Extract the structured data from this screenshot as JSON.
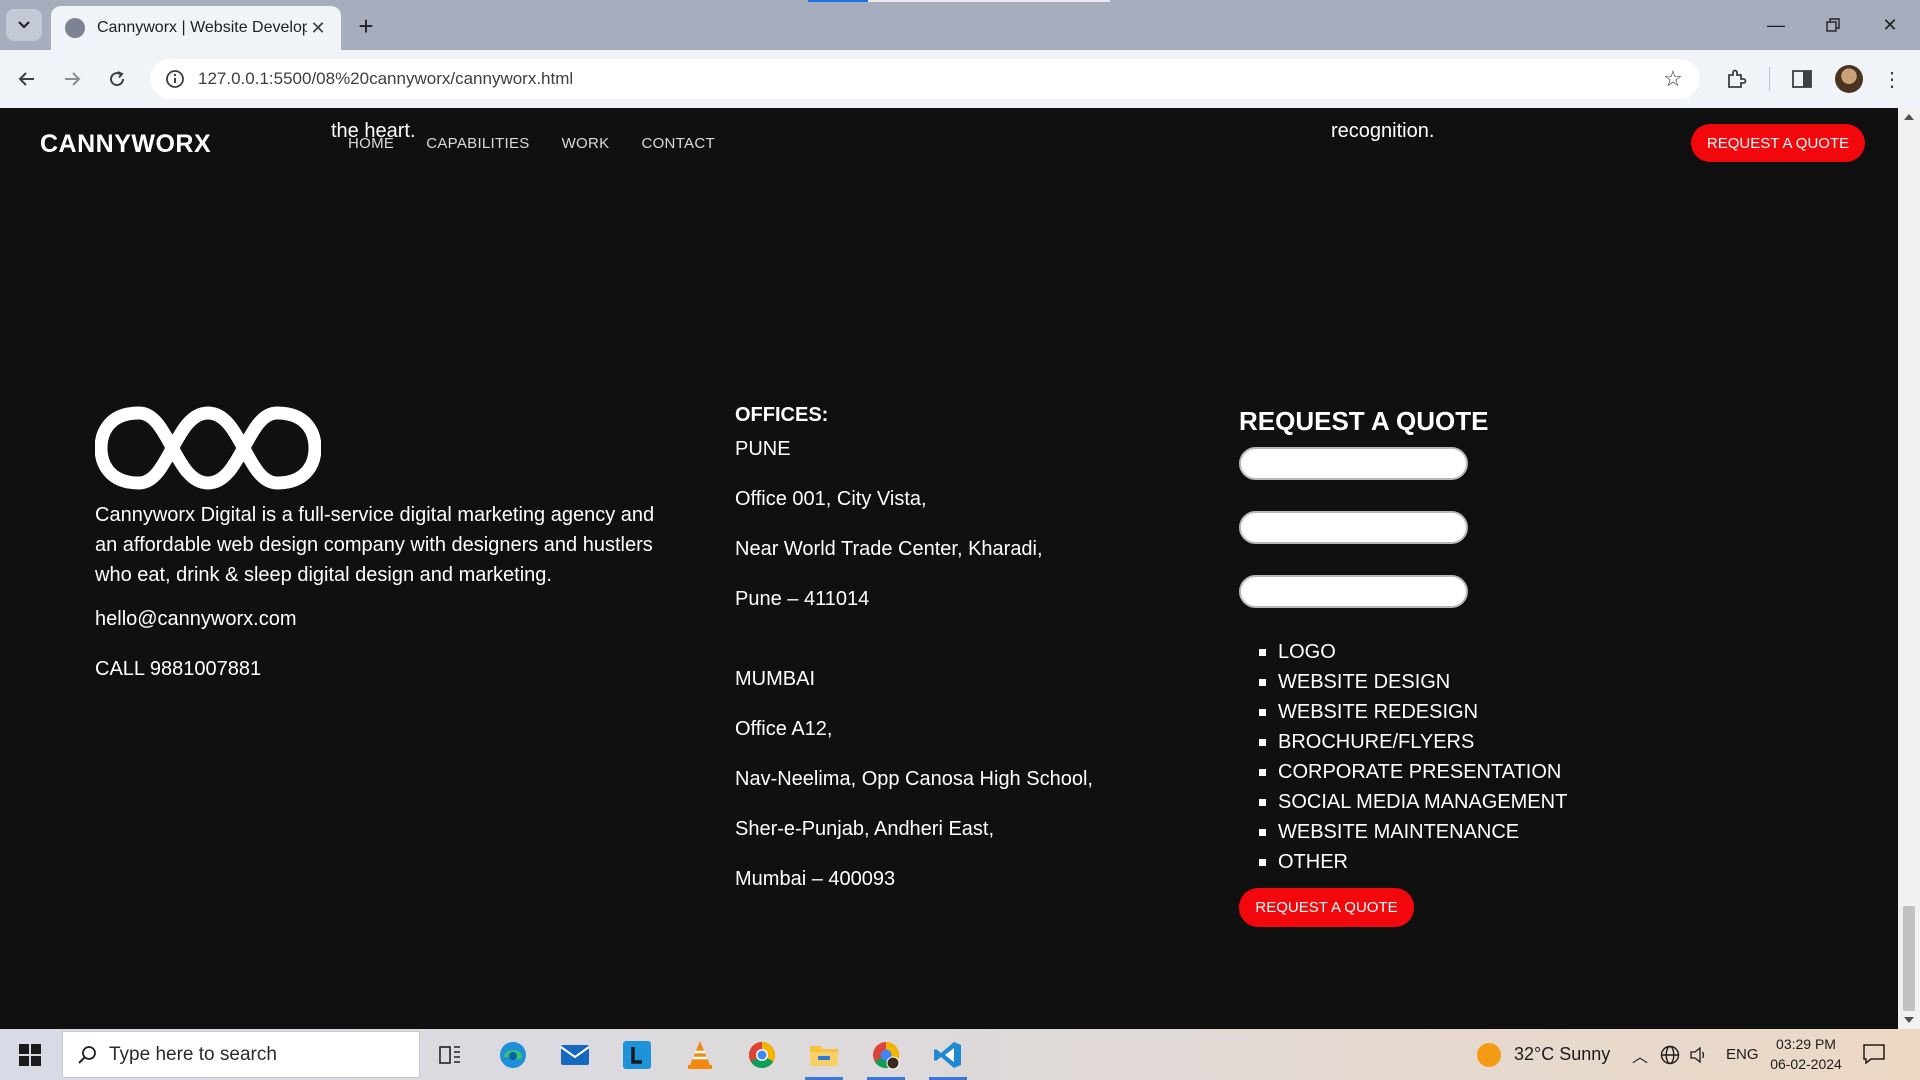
{
  "browser": {
    "tab_title": "Cannyworx | Website Developm",
    "url": "127.0.0.1:5500/08%20cannyworx/cannyworx.html"
  },
  "page": {
    "behind_left": "the heart.",
    "behind_right": "recognition.",
    "header": {
      "logo": "CANNYWORX",
      "nav": [
        "HOME",
        "CAPABILITIES",
        "WORK",
        "CONTACT"
      ],
      "quote_button": "REQUEST A QUOTE"
    },
    "footer": {
      "about": "Cannyworx Digital is a full-service digital marketing agency and an affordable web design company with designers and hustlers who eat, drink & sleep digital design and marketing.",
      "email": "hello@cannyworx.com",
      "phone": "CALL 9881007881",
      "offices_heading": "OFFICES:",
      "pune": [
        "PUNE",
        "Office 001, City Vista,",
        "Near World Trade Center, Kharadi,",
        "Pune – 411014"
      ],
      "mumbai": [
        "MUMBAI",
        "Office A12,",
        "Nav-Neelima, Opp Canosa High School,",
        "Sher-e-Punjab, Andheri East,",
        "Mumbai – 400093"
      ],
      "quote_heading": "REQUEST A QUOTE",
      "services": [
        "LOGO",
        "WEBSITE DESIGN",
        "WEBSITE REDESIGN",
        "BROCHURE/FLYERS",
        "CORPORATE PRESENTATION",
        "SOCIAL MEDIA MANAGEMENT",
        "WEBSITE MAINTENANCE",
        "OTHER"
      ],
      "submit_button": "REQUEST A QUOTE"
    }
  },
  "taskbar": {
    "search_placeholder": "Type here to search",
    "weather": "32°C  Sunny",
    "language": "ENG",
    "time": "03:29 PM",
    "date": "06-02-2024"
  },
  "colors": {
    "accent": "#f2080c",
    "page_bg": "#101010"
  }
}
